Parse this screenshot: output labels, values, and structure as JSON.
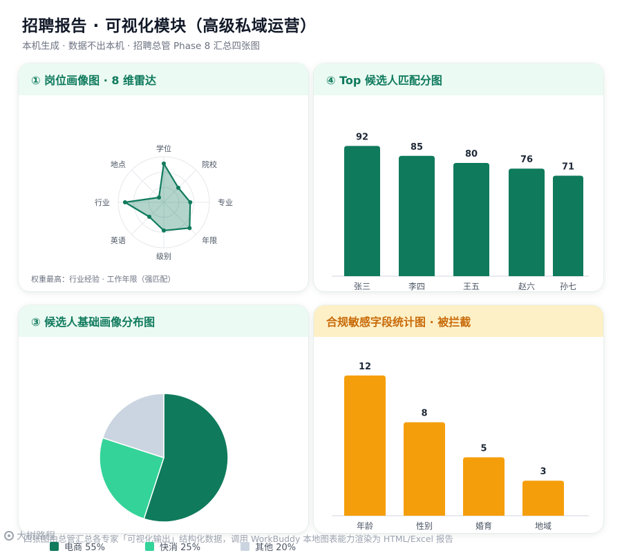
{
  "header": {
    "title": "招聘报告 · 可视化模块（高级私域运营）",
    "subtitle": "本机生成 · 数据不出本机 · 招聘总管 Phase 8 汇总四张图"
  },
  "colors": {
    "primary_green": "#0f7a5c",
    "light_green": "#34d399",
    "gray": "#cbd5e1",
    "orange": "#f59e0b",
    "orange_text": "#c86a08",
    "green_head_bg": "#ebfaf3",
    "orange_head_bg": "#fdf0c7"
  },
  "cards": {
    "radar": {
      "title": "① 岗位画像图 · 8 维雷达",
      "note": "权重最高：行业经验 · 工作年限（强匹配）"
    },
    "top": {
      "title": "④ Top 候选人匹配分图"
    },
    "pie": {
      "title": "③ 候选人基础画像分布图"
    },
    "sensitive": {
      "title": "合规敏感字段统计图 · 被拦截"
    }
  },
  "chart_data": [
    {
      "id": "radar",
      "type": "radar",
      "axes": [
        "学位",
        "院校",
        "专业",
        "年限",
        "级别",
        "英语",
        "行业",
        "地点"
      ],
      "values": [
        0.85,
        0.45,
        0.58,
        0.8,
        0.62,
        0.45,
        0.85,
        0.15
      ],
      "range": [
        0,
        1
      ],
      "grid": true
    },
    {
      "id": "top",
      "type": "bar",
      "categories": [
        "张三",
        "李四",
        "王五",
        "赵六",
        "孙七"
      ],
      "values": [
        92,
        85,
        80,
        76,
        71
      ],
      "ylim": [
        0,
        100
      ],
      "data_labels": true,
      "grid": false
    },
    {
      "id": "pie",
      "type": "pie",
      "slices": [
        {
          "label": "电商",
          "value": 55,
          "display": "电商 55%",
          "color": "#0f7a5c"
        },
        {
          "label": "快消",
          "value": 25,
          "display": "快消 25%",
          "color": "#34d399"
        },
        {
          "label": "其他",
          "value": 20,
          "display": "其他 20%",
          "color": "#cbd5e1"
        }
      ],
      "legend": "bottom"
    },
    {
      "id": "sensitive",
      "type": "bar",
      "categories": [
        "年龄",
        "性别",
        "婚育",
        "地域"
      ],
      "values": [
        12,
        8,
        5,
        3
      ],
      "ylim": [
        0,
        14
      ],
      "data_labels": true,
      "grid": false
    }
  ],
  "footer": {
    "note": "四张图由总管汇总各专家「可视化输出」结构化数据，调用 WorkBuddy 本地图表能力渲染为 HTML/Excel 报告",
    "watermark": "大树路程"
  }
}
